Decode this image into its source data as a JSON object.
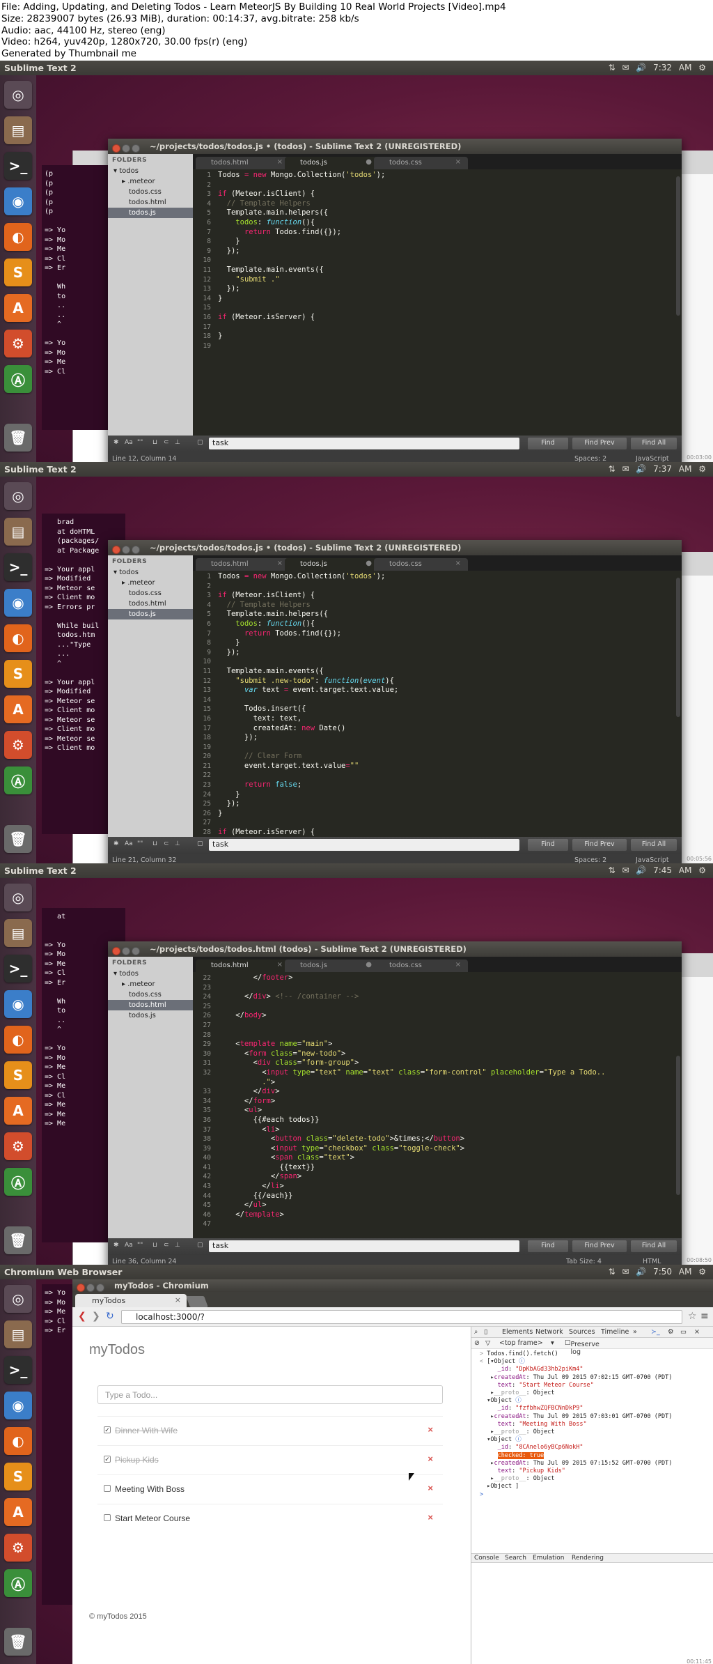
{
  "info": [
    "File: Adding, Updating, and Deleting Todos - Learn MeteorJS By Building 10 Real World Projects [Video].mp4",
    "Size: 28239007 bytes (26.93 MiB), duration: 00:14:37, avg.bitrate: 258 kb/s",
    "Audio: aac, 44100 Hz, stereo (eng)",
    "Video: h264, yuv420p, 1280x720, 30.00 fps(r) (eng)",
    "Generated by Thumbnail me"
  ],
  "frames": [
    {
      "app": "Sublime Text 2",
      "clock": "7:32 AM",
      "stamp": "00:03:00",
      "title": "~/projects/todos/todos.js • (todos) - Sublime Text 2 (UNREGISTERED)",
      "selected_file": "todos.js",
      "status_left": "Line 12, Column 14",
      "status_mid": "Spaces: 2",
      "status_right": "JavaScript",
      "find_value": "task"
    },
    {
      "app": "Sublime Text 2",
      "clock": "7:37 AM",
      "stamp": "00:05:56",
      "title": "~/projects/todos/todos.js • (todos) - Sublime Text 2 (UNREGISTERED)",
      "selected_file": "todos.js",
      "status_left": "Line 21, Column 32",
      "status_mid": "Spaces: 2",
      "status_right": "JavaScript",
      "find_value": "task"
    },
    {
      "app": "Sublime Text 2",
      "clock": "7:45 AM",
      "stamp": "00:08:50",
      "title": "~/projects/todos/todos.html (todos) - Sublime Text 2 (UNREGISTERED)",
      "selected_file": "todos.html",
      "status_left": "Line 36, Column 24",
      "status_mid": "Tab Size: 4",
      "status_right": "HTML",
      "find_value": "task"
    },
    {
      "app": "Chromium Web Browser",
      "clock": "7:50 AM",
      "stamp": "00:11:45",
      "title": "myTodos - Chromium"
    }
  ],
  "sidebar": {
    "header": "FOLDERS",
    "root": "todos",
    "items": [
      ".meteor",
      "todos.css",
      "todos.html",
      "todos.js"
    ]
  },
  "tabs": [
    "todos.html",
    "todos.js",
    "todos.css"
  ],
  "find_buttons": [
    "Find",
    "Find Prev",
    "Find All"
  ],
  "find_toggles": [
    "Aa",
    "\"\""
  ],
  "browser": {
    "tab": "myTodos",
    "url": "localhost:3000/?",
    "brand": "myTodos",
    "input_placeholder": "Type a Todo...",
    "todos": [
      {
        "text": "Dinner With Wife",
        "checked": true
      },
      {
        "text": "Pickup Kids",
        "checked": true
      },
      {
        "text": "Meeting With Boss",
        "checked": false
      },
      {
        "text": "Start Meteor Course",
        "checked": false
      }
    ],
    "footer": "© myTodos 2015",
    "devtools_tabs": [
      "Elements",
      "Network",
      "Sources",
      "Timeline"
    ],
    "frame_select": "<top frame>",
    "preserve_log": "Preserve log",
    "console_tabs": [
      "Console",
      "Search",
      "Emulation",
      "Rendering"
    ],
    "console_cmd": "Todos.find().fetch()"
  }
}
